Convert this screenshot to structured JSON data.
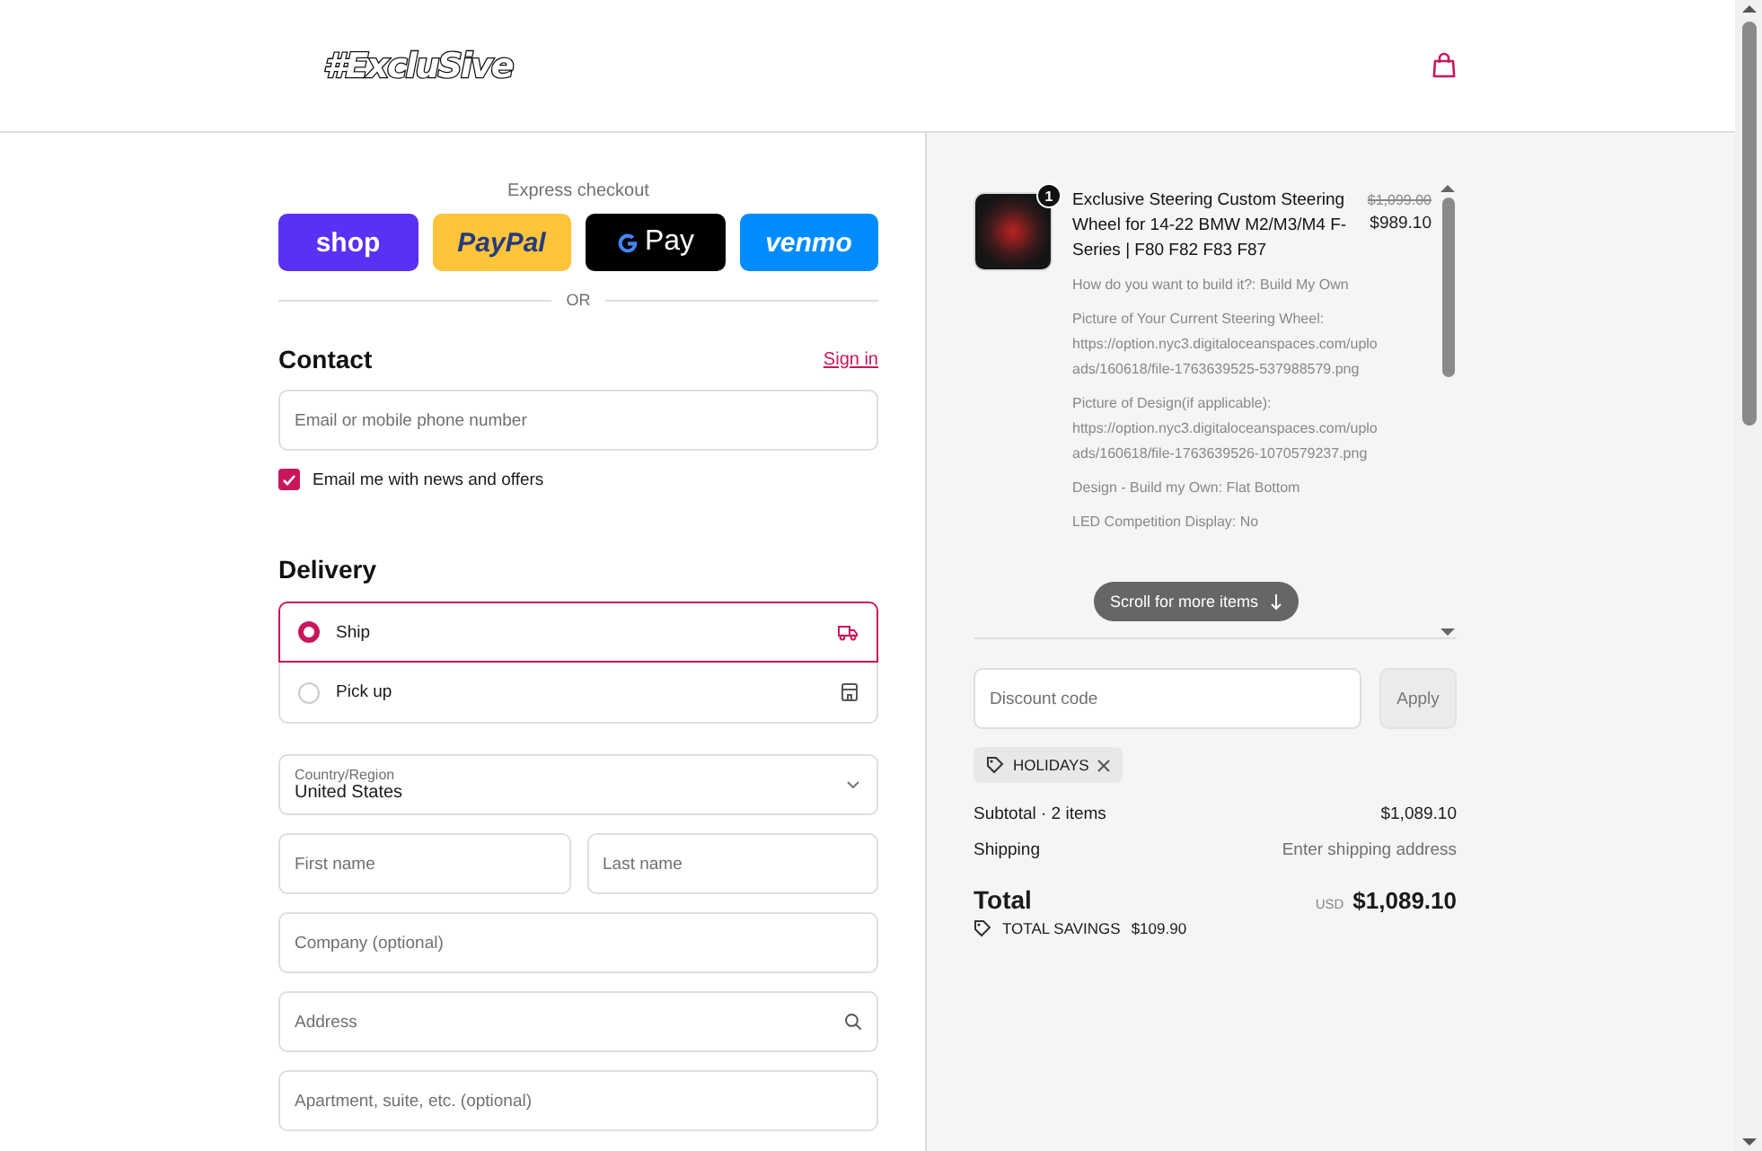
{
  "header": {
    "logo": "#ExcluSive"
  },
  "express_checkout": {
    "label": "Express checkout",
    "buttons": [
      {
        "kind": "shop",
        "label": "shop"
      },
      {
        "kind": "paypal",
        "label": "PayPal"
      },
      {
        "kind": "gpay",
        "label": "Pay"
      },
      {
        "kind": "venmo",
        "label": "venmo"
      }
    ],
    "divider": "OR"
  },
  "contact": {
    "heading": "Contact",
    "sign_in": "Sign in",
    "email_placeholder": "Email or mobile phone number",
    "newsletter": {
      "label": "Email me with news and offers",
      "checked": true
    }
  },
  "delivery": {
    "heading": "Delivery",
    "options": [
      {
        "kind": "ship",
        "label": "Ship",
        "selected": true
      },
      {
        "kind": "pickup",
        "label": "Pick up",
        "selected": false
      }
    ],
    "country": {
      "label": "Country/Region",
      "value": "United States"
    },
    "fields": [
      {
        "kind": "half",
        "placeholder": "First name"
      },
      {
        "kind": "half",
        "placeholder": "Last name"
      },
      {
        "kind": "text",
        "placeholder": "Company (optional)"
      },
      {
        "kind": "search",
        "placeholder": "Address"
      },
      {
        "kind": "text",
        "placeholder": "Apartment, suite, etc. (optional)"
      }
    ]
  },
  "summary": {
    "item": {
      "quantity": "1",
      "title": "Exclusive Steering Custom Steering Wheel for 14-22 BMW M2/M3/M4 F-Series | F80 F82 F83 F87",
      "compare_price": "$1,099.00",
      "price": "$989.10",
      "options": [
        "How do you want to build it?: Build My Own",
        "Picture of Your Current Steering Wheel: https://option.nyc3.digitaloceanspaces.com/uploads/160618/file-1763639525-537988579.png",
        "Picture of Design(if applicable): https://option.nyc3.digitaloceanspaces.com/uploads/160618/file-1763639526-1070579237.png",
        "Design - Build my Own: Flat Bottom",
        "LED Competition Display: No"
      ]
    },
    "scroll_hint": "Scroll for more items",
    "discount": {
      "placeholder": "Discount code",
      "button": "Apply"
    },
    "applied_code": "HOLIDAYS",
    "subtotal_label": "Subtotal · 2 items",
    "subtotal_value": "$1,089.10",
    "shipping_label": "Shipping",
    "shipping_value": "Enter shipping address",
    "total_label": "Total",
    "currency": "USD",
    "total_value": "$1,089.10",
    "savings_label": "TOTAL SAVINGS",
    "savings_value": "$109.90"
  }
}
